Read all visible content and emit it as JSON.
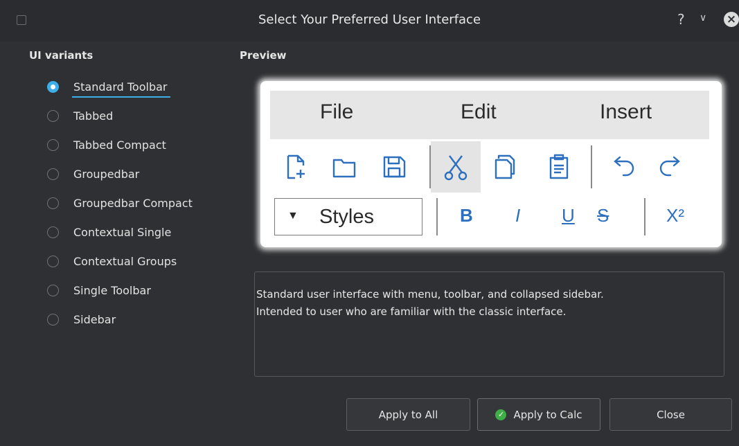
{
  "window": {
    "title": "Select Your Preferred User Interface",
    "help_glyph": "?",
    "minimize_glyph": "∨",
    "close_glyph": "×"
  },
  "variants": {
    "label": "UI variants",
    "items": [
      {
        "label": "Standard Toolbar",
        "checked": true
      },
      {
        "label": "Tabbed",
        "checked": false
      },
      {
        "label": "Tabbed Compact",
        "checked": false
      },
      {
        "label": "Groupedbar",
        "checked": false
      },
      {
        "label": "Groupedbar Compact",
        "checked": false
      },
      {
        "label": "Contextual Single",
        "checked": false
      },
      {
        "label": "Contextual Groups",
        "checked": false
      },
      {
        "label": "Single Toolbar",
        "checked": false
      },
      {
        "label": "Sidebar",
        "checked": false
      }
    ]
  },
  "preview": {
    "label": "Preview",
    "menu": [
      "File",
      "Edit",
      "Insert"
    ],
    "toolbar_icons": [
      "new-document-icon",
      "open-folder-icon",
      "save-icon",
      "cut-icon",
      "copy-icon",
      "paste-icon",
      "undo-icon",
      "redo-icon"
    ],
    "styles_label": "Styles",
    "styles_arrow": "▼",
    "format": {
      "bold": "B",
      "italic": "I",
      "underline": "U",
      "strike": "S",
      "superscript": "X²"
    }
  },
  "description": {
    "line1": "Standard user interface with menu, toolbar, and collapsed sidebar.",
    "line2": "Intended to user who are familiar with the classic interface."
  },
  "buttons": {
    "apply_all": "Apply to All",
    "apply_calc": "Apply to Calc",
    "close": "Close"
  },
  "colors": {
    "accent": "#3daee9",
    "background": "#2f3033",
    "format_blue": "#2c6fbf"
  }
}
